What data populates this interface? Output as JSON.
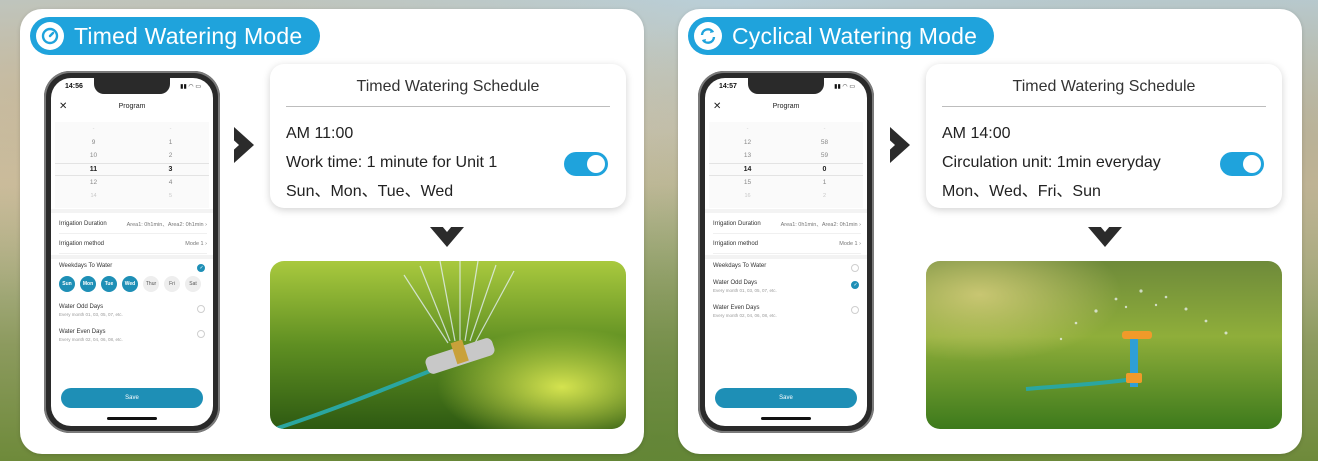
{
  "left": {
    "mode_title": "Timed Watering Mode",
    "mode_icon": "timer-icon",
    "phone": {
      "time": "14:56",
      "title": "Program",
      "picker_rows": [
        {
          "h": "-",
          "m": "-"
        },
        {
          "h": "9",
          "m": "1"
        },
        {
          "h": "10",
          "m": "2"
        },
        {
          "h": "11",
          "m": "3"
        },
        {
          "h": "12",
          "m": "4"
        },
        {
          "h": "14",
          "m": "5"
        }
      ],
      "irrigation_duration_label": "Irrigation Duration",
      "irrigation_duration_value": "Area1: 0h1min、Area2: 0h1min",
      "irrigation_method_label": "Irrigation method",
      "irrigation_method_value": "Mode 1",
      "weekdays_label": "Weekdays To Water",
      "days": [
        "Sun",
        "Mon",
        "Tue",
        "Wed",
        "Thur",
        "Fri",
        "Sat"
      ],
      "odd_label": "Water Odd Days",
      "odd_sub": "Every month 01, 03, 05, 07, etc.",
      "even_label": "Water Even Days",
      "even_sub": "Every month 02, 04, 06, 08, etc.",
      "save_label": "Save"
    },
    "card": {
      "title": "Timed Watering Schedule",
      "time": "AM 11:00",
      "work": "Work  time: 1 minute for Unit 1",
      "days": "Sun、Mon、Tue、Wed",
      "toggle_on": true
    }
  },
  "right": {
    "mode_title": "Cyclical Watering Mode",
    "mode_icon": "cycle-icon",
    "phone": {
      "time": "14:57",
      "title": "Program",
      "picker_rows": [
        {
          "h": "-",
          "m": "-"
        },
        {
          "h": "12",
          "m": "58"
        },
        {
          "h": "13",
          "m": "59"
        },
        {
          "h": "14",
          "m": "0"
        },
        {
          "h": "15",
          "m": "1"
        },
        {
          "h": "16",
          "m": "2"
        }
      ],
      "irrigation_duration_label": "Irrigation Duration",
      "irrigation_duration_value": "Area1: 0h1min、Area2: 0h1min",
      "irrigation_method_label": "Irrigation method",
      "irrigation_method_value": "Mode 1",
      "weekdays_label": "Weekdays To Water",
      "odd_label": "Water Odd Days",
      "odd_sub": "Every month 01, 03, 05, 07, etc.",
      "even_label": "Water Even Days",
      "even_sub": "Every month 02, 04, 06, 08, etc.",
      "save_label": "Save"
    },
    "card": {
      "title": "Timed Watering Schedule",
      "time": "AM 14:00",
      "work": "Circulation unit: 1min everyday",
      "days": "Mon、Wed、Fri、Sun",
      "toggle_on": true
    }
  },
  "colors": {
    "accent": "#1fa3dc",
    "app_button": "#1e8fb6",
    "arrow": "#2b2b2b"
  }
}
